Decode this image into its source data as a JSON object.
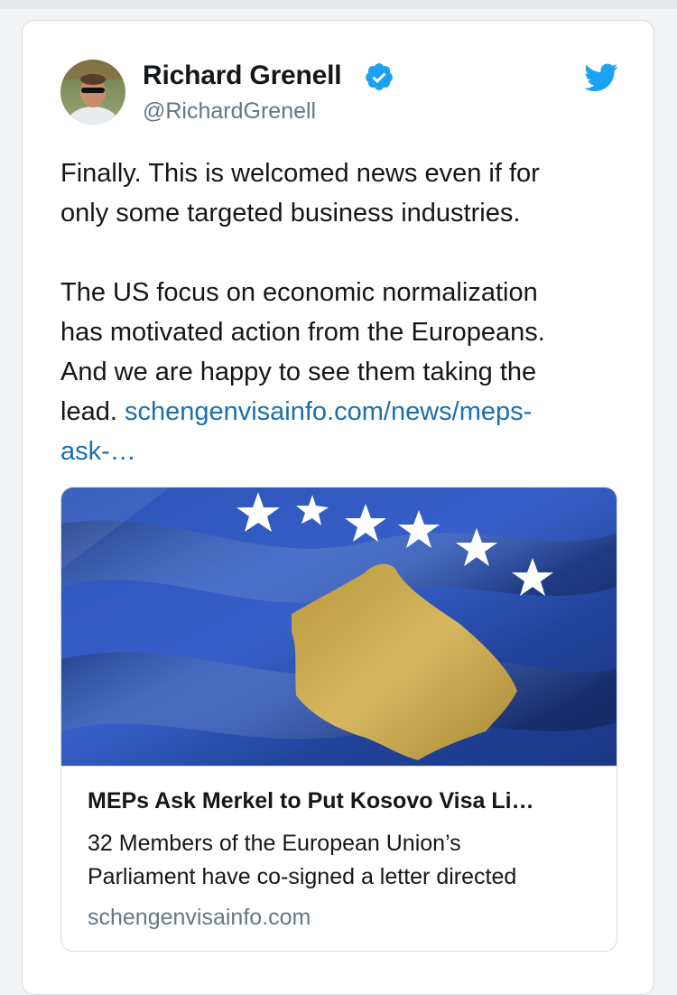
{
  "author": {
    "display_name": "Richard Grenell",
    "handle": "@RichardGrenell",
    "verified": true,
    "avatar_icon": "profile-photo"
  },
  "tweet": {
    "line1": "Finally. This is welcomed news even if for",
    "line2": "only some targeted business industries.",
    "line3": "The US focus on economic normalization",
    "line4": "has motivated action from the Europeans.",
    "line5": "And we are happy to see them taking the",
    "line6_text": "lead. ",
    "link_part1": "schengenvisainfo.com/news/meps-",
    "link_part2": "ask-…"
  },
  "link_card": {
    "image_icon": "kosovo-flag",
    "title": "MEPs Ask Merkel to Put Kosovo Visa Li…",
    "desc_line1": "32 Members of the European Union’s",
    "desc_line2": "Parliament have co-signed a letter directed",
    "domain": "schengenvisainfo.com"
  },
  "colors": {
    "link": "#1b6fb0",
    "twitter_blue": "#1da1f2",
    "secondary_text": "#657786",
    "flag_blue": "#2a4fb0",
    "flag_gold": "#c9a84a"
  },
  "icons": [
    "verified-badge-icon",
    "twitter-bird-icon"
  ]
}
